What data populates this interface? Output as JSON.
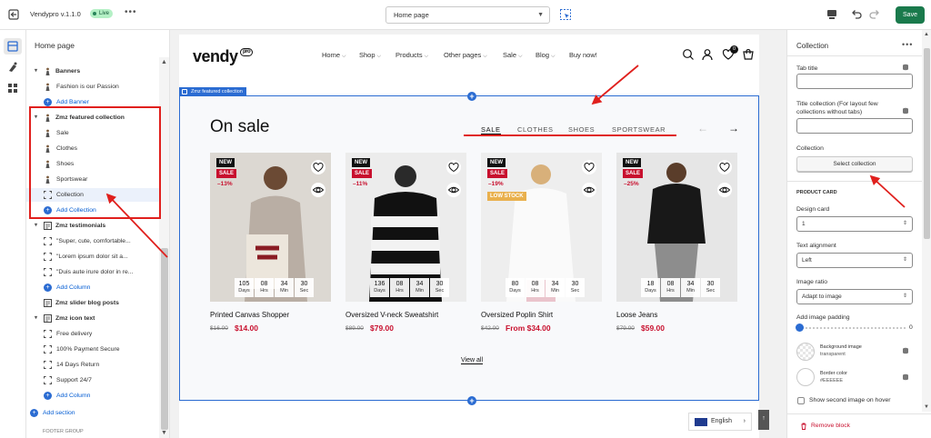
{
  "topbar": {
    "app_version": "Vendypro v.1.1.0",
    "live_badge": "Live",
    "more": "•••",
    "page_select": "Home page",
    "save": "Save"
  },
  "left_panel": {
    "title": "Home page",
    "rows": [
      {
        "label": "Banners",
        "kind": "section",
        "expanded": true,
        "icon": "person-icon"
      },
      {
        "label": "Fashion is our Passion",
        "kind": "item",
        "icon": "person-icon"
      },
      {
        "label": "Add Banner",
        "kind": "add"
      },
      {
        "label": "Zmz featured collection",
        "kind": "section",
        "expanded": true,
        "icon": "person-icon"
      },
      {
        "label": "Sale",
        "kind": "item",
        "icon": "person-icon"
      },
      {
        "label": "Clothes",
        "kind": "item",
        "icon": "person-icon"
      },
      {
        "label": "Shoes",
        "kind": "item",
        "icon": "person-icon"
      },
      {
        "label": "Sportswear",
        "kind": "item",
        "icon": "person-icon"
      },
      {
        "label": "Collection",
        "kind": "item",
        "icon": "block-icon",
        "selected": true
      },
      {
        "label": "Add Collection",
        "kind": "add"
      },
      {
        "label": "Zmz testimonials",
        "kind": "section",
        "expanded": true,
        "icon": "text-icon"
      },
      {
        "label": "\"Super, cute, comfortable...",
        "kind": "item",
        "icon": "block-icon"
      },
      {
        "label": "\"Lorem ipsum dolor sit a...",
        "kind": "item",
        "icon": "block-icon"
      },
      {
        "label": "\"Duis aute irure dolor in re...",
        "kind": "item",
        "icon": "block-icon"
      },
      {
        "label": "Add Column",
        "kind": "add"
      },
      {
        "label": "Zmz slider blog posts",
        "kind": "section",
        "expanded": false,
        "icon": "text-icon"
      },
      {
        "label": "Zmz icon text",
        "kind": "section",
        "expanded": true,
        "icon": "text-icon"
      },
      {
        "label": "Free delivery",
        "kind": "item",
        "icon": "block-icon"
      },
      {
        "label": "100% Payment Secure",
        "kind": "item",
        "icon": "block-icon"
      },
      {
        "label": "14 Days Return",
        "kind": "item",
        "icon": "block-icon"
      },
      {
        "label": "Support 24/7",
        "kind": "item",
        "icon": "block-icon"
      },
      {
        "label": "Add Column",
        "kind": "add"
      },
      {
        "label": "Add section",
        "kind": "add-section"
      },
      {
        "label": "FOOTER GROUP",
        "kind": "group"
      }
    ]
  },
  "store": {
    "logo": "vendy",
    "logo_badge": "pro",
    "nav": [
      "Home",
      "Shop",
      "Products",
      "Other pages",
      "Sale",
      "Blog",
      "Buy now!"
    ],
    "cart_count": "0",
    "section_tag": "Zmz featured collection",
    "heading": "On sale",
    "tabs": [
      "SALE",
      "CLOTHES",
      "SHOES",
      "SPORTSWEAR"
    ],
    "view_all": "View all",
    "language": "English",
    "products": [
      {
        "name": "Printed Canvas Shopper",
        "old": "$16.00",
        "price": "$14.00",
        "from": false,
        "badges": [
          "NEW",
          "SALE"
        ],
        "discount": "–13%",
        "low_stock": "",
        "timer": [
          "105",
          "08",
          "34",
          "30"
        ],
        "bg": "#dcd8d2"
      },
      {
        "name": "Oversized V-neck Sweatshirt",
        "old": "$89.00",
        "price": "$79.00",
        "from": false,
        "badges": [
          "NEW",
          "SALE"
        ],
        "discount": "–11%",
        "low_stock": "",
        "timer": [
          "136",
          "08",
          "34",
          "30"
        ],
        "bg": "#ececec"
      },
      {
        "name": "Oversized Poplin Shirt",
        "old": "$42.00",
        "price": "From $34.00",
        "from": true,
        "badges": [
          "NEW",
          "SALE"
        ],
        "discount": "–19%",
        "low_stock": "LOW STOCK",
        "timer": [
          "80",
          "08",
          "34",
          "30"
        ],
        "bg": "#eeeeee"
      },
      {
        "name": "Loose Jeans",
        "old": "$79.00",
        "price": "$59.00",
        "from": false,
        "badges": [
          "NEW",
          "SALE"
        ],
        "discount": "–25%",
        "low_stock": "",
        "timer": [
          "18",
          "08",
          "34",
          "30"
        ],
        "bg": "#e6e6e6"
      }
    ],
    "timer_units": [
      "Days",
      "Hrs",
      "Min",
      "Sec"
    ]
  },
  "right_panel": {
    "title": "Collection",
    "tab_title_label": "Tab title",
    "tab_title_value": "",
    "title_collection_label_1": "Title collection (For layout few",
    "title_collection_label_2": "collections without tabs)",
    "title_collection_value": "",
    "collection_label": "Collection",
    "select_collection": "Select collection",
    "product_card_heading": "PRODUCT CARD",
    "design_card_label": "Design card",
    "design_card_value": "1",
    "text_alignment_label": "Text alignment",
    "text_alignment_value": "Left",
    "image_ratio_label": "Image ratio",
    "image_ratio_value": "Adapt to image",
    "image_padding_label": "Add image padding",
    "image_padding_value": "0",
    "bg_image_label": "Background image",
    "bg_image_value": "transparent",
    "border_color_label": "Border color",
    "border_color_value": "#EEEEEE",
    "second_image_label": "Show second image on hover",
    "remove_block": "Remove block"
  },
  "colors": {
    "accent_blue": "#2b6cd2",
    "save_green": "#1a7a4c",
    "sale_red": "#c8102e",
    "annotation_red": "#e0201d"
  }
}
